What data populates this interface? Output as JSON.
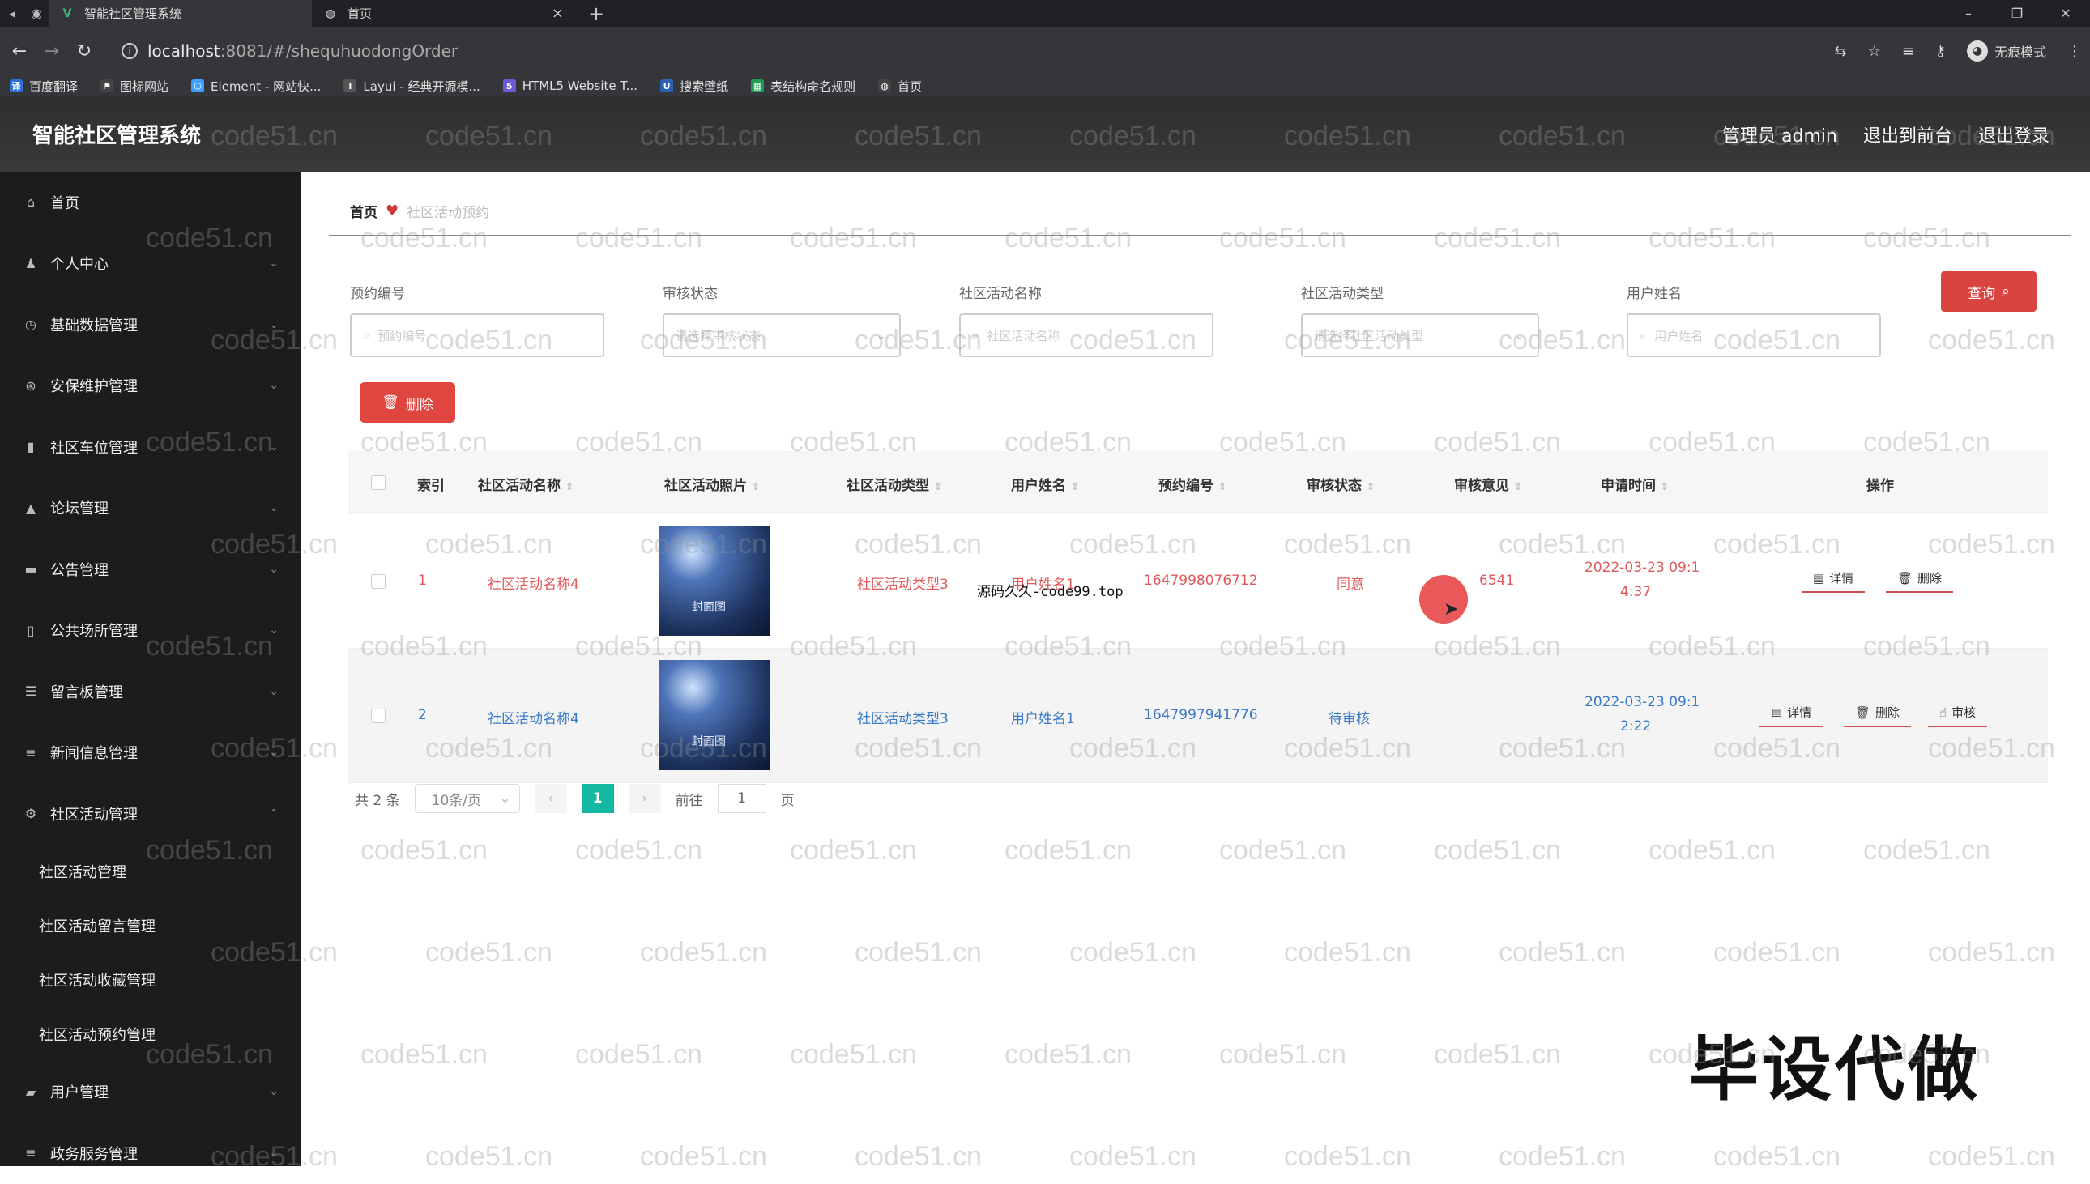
{
  "browser": {
    "tabs": [
      {
        "title": "智能社区管理系统",
        "active": true
      },
      {
        "title": "首页",
        "active": false
      }
    ],
    "url_host": "localhost",
    "url_rest": ":8081/#/shequhuodongOrder",
    "profile_label": "无痕模式",
    "bookmarks": [
      "百度翻译",
      "图标网站",
      "Element - 网站快...",
      "Layui - 经典开源模...",
      "HTML5 Website T...",
      "搜索壁纸",
      "表结构命名规则",
      "首页"
    ]
  },
  "header": {
    "title": "智能社区管理系统",
    "admin": "管理员 admin",
    "to_front": "退出到前台",
    "logout": "退出登录"
  },
  "sidebar": {
    "items": [
      {
        "label": "首页",
        "icon": "home-icon"
      },
      {
        "label": "个人中心",
        "icon": "user-icon"
      },
      {
        "label": "基础数据管理",
        "icon": "clock-icon"
      },
      {
        "label": "安保维护管理",
        "icon": "shield-icon"
      },
      {
        "label": "社区车位管理",
        "icon": "chart-icon"
      },
      {
        "label": "论坛管理",
        "icon": "forum-icon"
      },
      {
        "label": "公告管理",
        "icon": "message-icon"
      },
      {
        "label": "公共场所管理",
        "icon": "phone-icon"
      },
      {
        "label": "留言板管理",
        "icon": "list-icon"
      },
      {
        "label": "新闻信息管理",
        "icon": "menu-icon"
      },
      {
        "label": "社区活动管理",
        "icon": "gear-icon"
      }
    ],
    "subitems": [
      "社区活动管理",
      "社区活动留言管理",
      "社区活动收藏管理",
      "社区活动预约管理"
    ],
    "items_after": [
      {
        "label": "用户管理",
        "icon": "folder-icon"
      },
      {
        "label": "政务服务管理",
        "icon": "menu-icon"
      }
    ]
  },
  "breadcrumb": {
    "home": "首页",
    "current": "社区活动预约"
  },
  "filters": {
    "order_no": {
      "label": "预约编号",
      "placeholder": "预约编号"
    },
    "status": {
      "label": "审核状态",
      "placeholder": "请选择审核状态"
    },
    "activity_name": {
      "label": "社区活动名称",
      "placeholder": "社区活动名称"
    },
    "activity_type": {
      "label": "社区活动类型",
      "placeholder": "请选择社区活动类型"
    },
    "user_name": {
      "label": "用户姓名",
      "placeholder": "用户姓名"
    },
    "query_label": "查询",
    "delete_label": "删除"
  },
  "table": {
    "headers": [
      "索引",
      "社区活动名称",
      "社区活动照片",
      "社区活动类型",
      "用户姓名",
      "预约编号",
      "审核状态",
      "审核意见",
      "申请时间",
      "操作"
    ],
    "rows": [
      {
        "index": "1",
        "name": "社区活动名称4",
        "photo_text": "封面图",
        "type": "社区活动类型3",
        "user": "用户姓名1",
        "order_no": "1647998076712",
        "status": "同意",
        "opinion": "6541",
        "time1": "2022-03-23 09:1",
        "time2": "4:37",
        "actions": [
          "详情",
          "删除"
        ],
        "color": "#e05a5a"
      },
      {
        "index": "2",
        "name": "社区活动名称4",
        "photo_text": "封面图",
        "type": "社区活动类型3",
        "user": "用户姓名1",
        "order_no": "1647997941776",
        "status": "待审核",
        "opinion": "",
        "time1": "2022-03-23 09:1",
        "time2": "2:22",
        "actions": [
          "详情",
          "删除",
          "审核"
        ],
        "color": "#3a78c8"
      }
    ]
  },
  "pager": {
    "total": "共 2 条",
    "size": "10条/页",
    "current": "1",
    "goto": "前往",
    "page_input": "1",
    "page_suffix": "页"
  },
  "overlay": {
    "note": "源码久久-code99.top",
    "promo": "毕设代做",
    "watermark": "code51.cn"
  }
}
